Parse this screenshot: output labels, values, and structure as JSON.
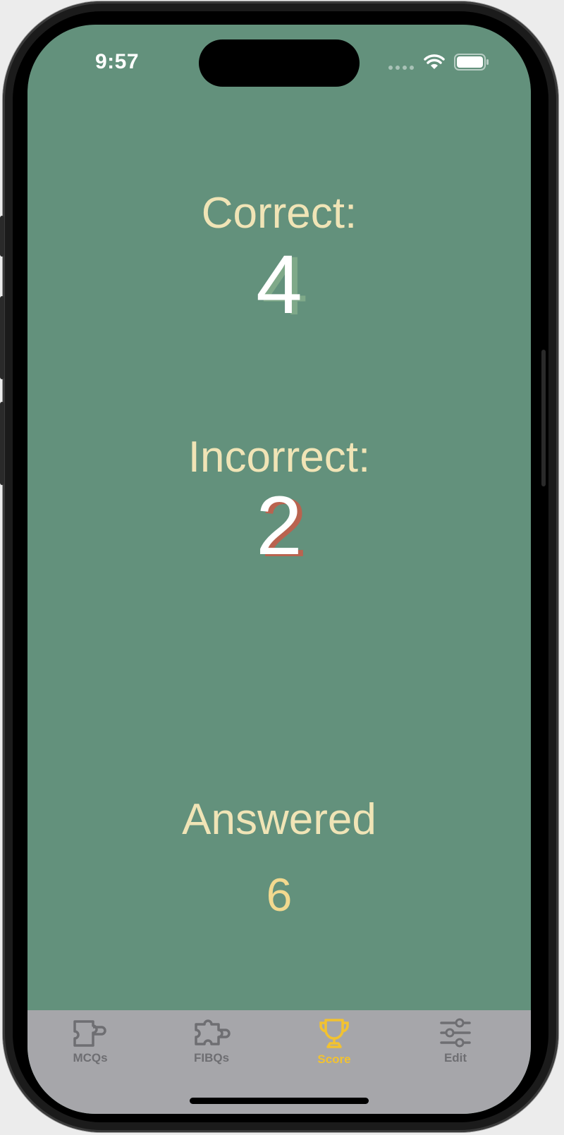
{
  "status_bar": {
    "time": "9:57"
  },
  "score": {
    "correct_label": "Correct:",
    "correct_value": "4",
    "incorrect_label": "Incorrect:",
    "incorrect_value": "2",
    "answered_label": "Answered",
    "answered_value": "6"
  },
  "tab_bar": {
    "tabs": [
      {
        "label": "MCQs",
        "icon": "puzzle-piece-icon",
        "active": false
      },
      {
        "label": "FIBQs",
        "icon": "puzzle-icon",
        "active": false
      },
      {
        "label": "Score",
        "icon": "trophy-icon",
        "active": true
      },
      {
        "label": "Edit",
        "icon": "sliders-icon",
        "active": false
      }
    ]
  },
  "colors": {
    "background": "#63917c",
    "label_text": "#f0e4b6",
    "value_text": "#ffffff",
    "correct_shadow": "#7fa989",
    "incorrect_shadow": "#b9634f",
    "answered_value": "#f2d98f",
    "tab_bar": "#a6a6aa",
    "tab_inactive": "#6e6e72",
    "tab_active": "#f2c230"
  }
}
